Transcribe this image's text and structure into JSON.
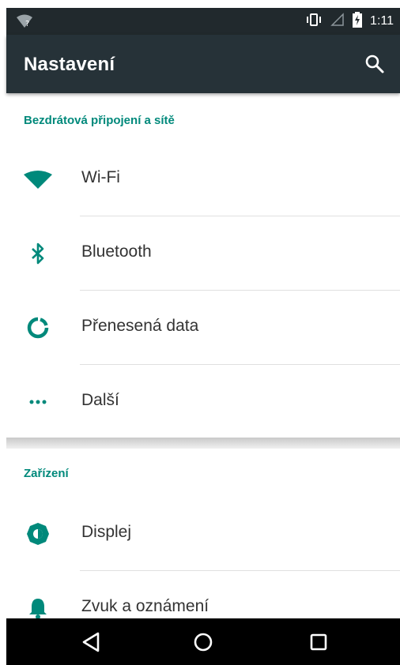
{
  "status_bar": {
    "time": "1:11",
    "icons": [
      "wifi-question-icon",
      "vibrate-icon",
      "signal-icon",
      "battery-charging-icon"
    ]
  },
  "toolbar": {
    "title": "Nastavení",
    "search_icon": "search-icon"
  },
  "sections": [
    {
      "header": "Bezdrátová připojení a sítě",
      "items": [
        {
          "label": "Wi-Fi",
          "icon": "wifi-icon"
        },
        {
          "label": "Bluetooth",
          "icon": "bluetooth-icon"
        },
        {
          "label": "Přenesená data",
          "icon": "data-usage-icon"
        },
        {
          "label": "Další",
          "icon": "more-dots-icon"
        }
      ]
    },
    {
      "header": "Zařízení",
      "items": [
        {
          "label": "Displej",
          "icon": "brightness-icon"
        },
        {
          "label": "Zvuk a oznámení",
          "icon": "bell-icon"
        }
      ]
    }
  ],
  "nav_bar": {
    "icons": [
      "back-icon",
      "home-icon",
      "recents-icon"
    ]
  },
  "colors": {
    "accent": "#00897b",
    "toolbar": "#263238",
    "status_bar": "#21292d"
  }
}
